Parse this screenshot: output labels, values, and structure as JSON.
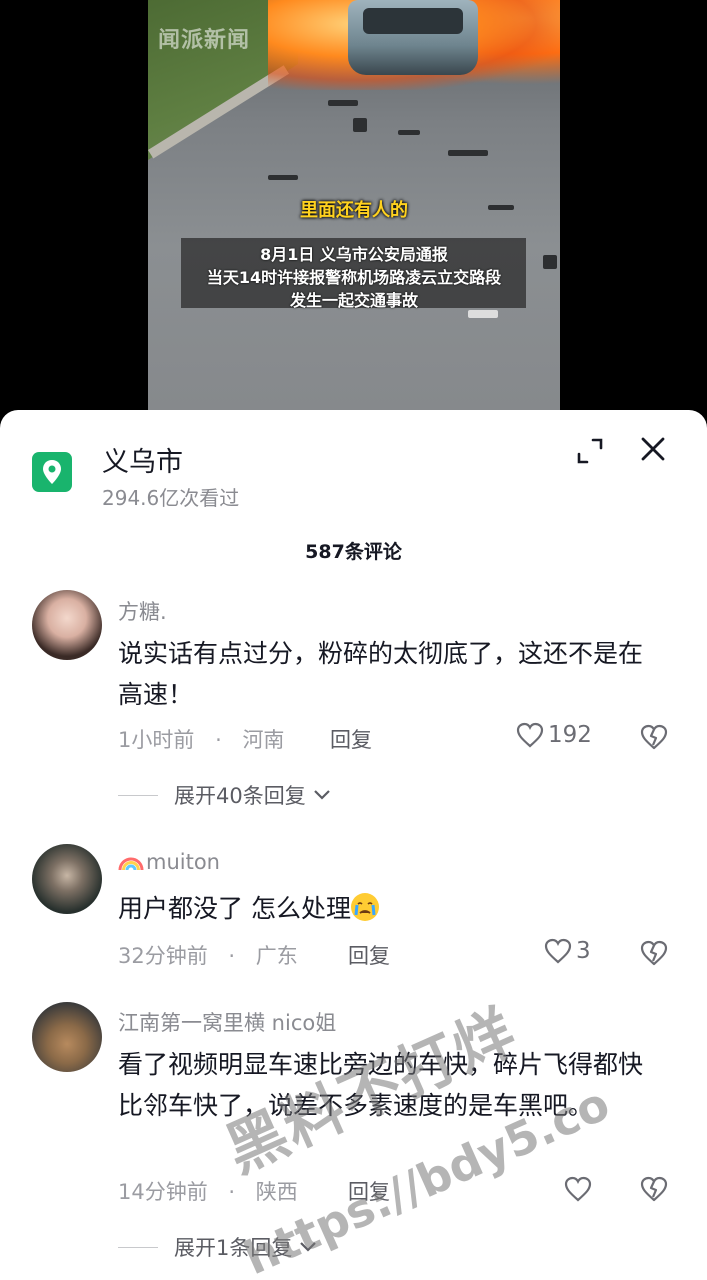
{
  "video": {
    "channel_watermark": "闻派新闻",
    "subtitle_highlight": "里面还有人的",
    "subtitle_lines": [
      "8月1日 义乌市公安局通报",
      "当天14时许接报警称机场路凌云立交路段",
      "发生一起交通事故"
    ]
  },
  "header": {
    "location_title": "义乌市",
    "views": "294.6亿次看过",
    "expand_icon": "fullscreen-icon",
    "close_icon": "close-icon"
  },
  "comments_count": "587条评论",
  "comments": [
    {
      "user": "方糖.",
      "text": "说实话有点过分，粉碎的太彻底了，这还不是在高速！",
      "time": "1小时前",
      "location": "河南",
      "reply": "回复",
      "likes": "192",
      "expand": "展开40条回复"
    },
    {
      "user": "muiton",
      "text": "用户都没了 怎么处理",
      "time": "32分钟前",
      "location": "广东",
      "reply": "回复",
      "likes": "3"
    },
    {
      "user": "江南第一窝里横 nico姐",
      "text": "看了视频明显车速比旁边的车快，碎片飞得都快比邻车快了，说差不多素速度的是车黑吧。",
      "time": "14分钟前",
      "location": "陕西",
      "reply": "回复",
      "likes": "",
      "expand": "展开1条回复"
    }
  ],
  "overlay_watermark": {
    "line1": "黑料不打烊",
    "line2": "https://bdy5.co"
  },
  "colors": {
    "location_green": "#19b46d",
    "text_primary": "#161823",
    "text_secondary": "#8a8b91"
  }
}
